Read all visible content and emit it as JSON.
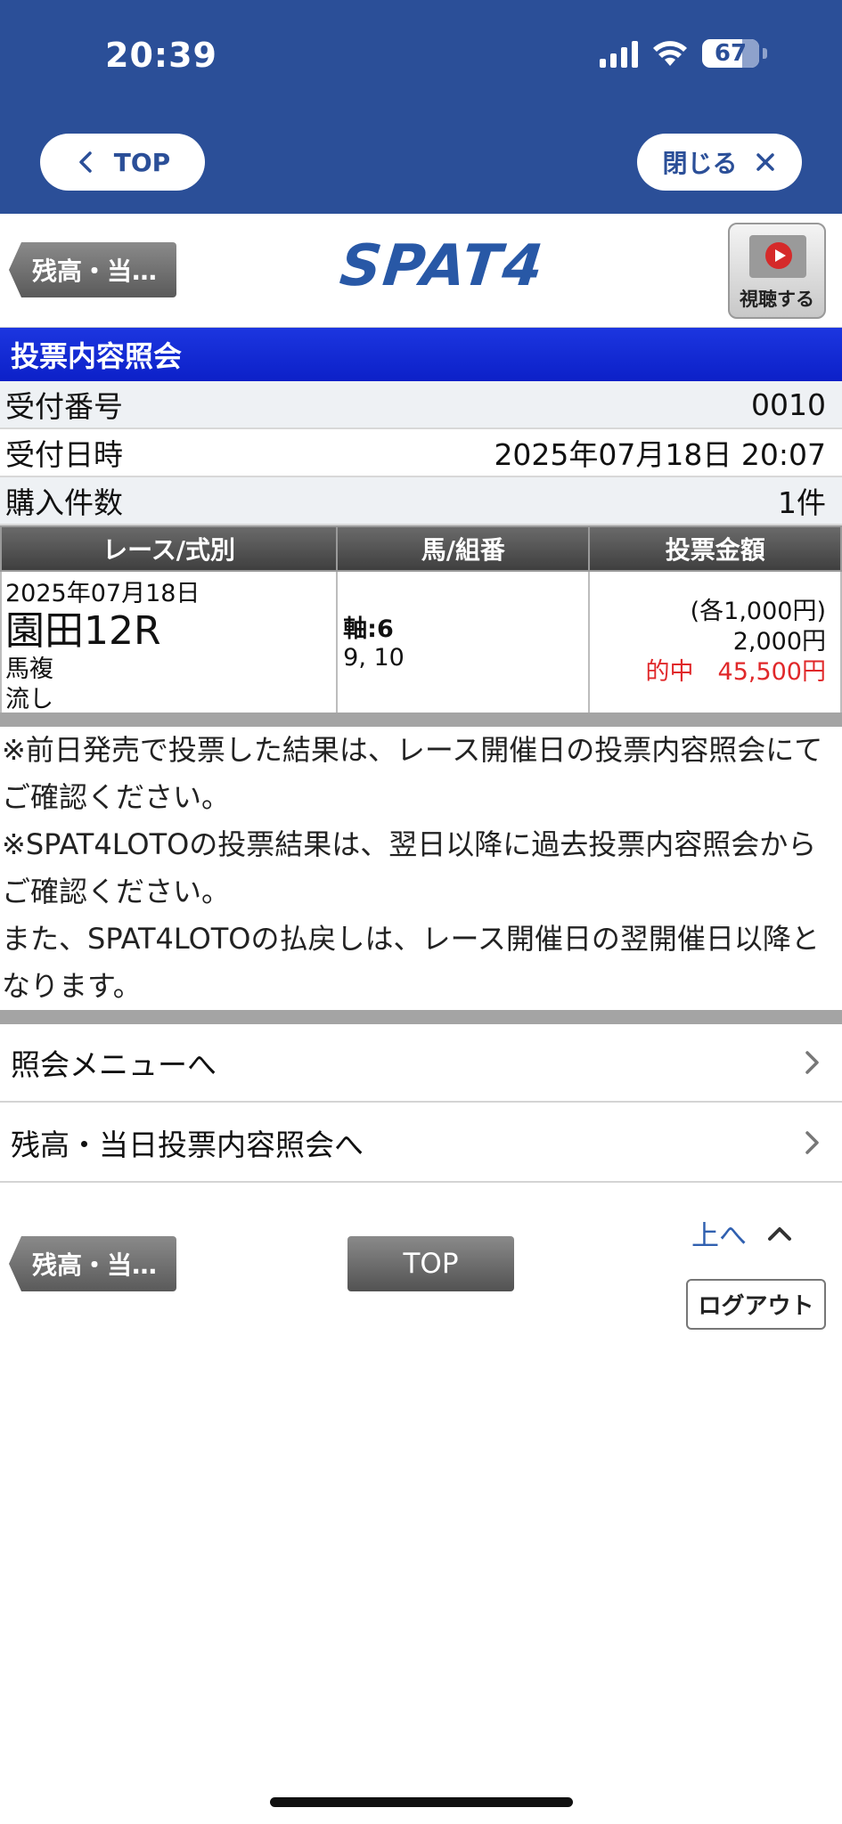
{
  "status_bar": {
    "time": "20:39",
    "battery": "67"
  },
  "header": {
    "top_label": "TOP",
    "close_label": "閉じる"
  },
  "logo_row": {
    "back_label": "残高・当…",
    "logo": "SPAT4",
    "watch_label": "視聴する"
  },
  "section": {
    "title": "投票内容照会"
  },
  "info": [
    {
      "label": "受付番号",
      "value": "0010"
    },
    {
      "label": "受付日時",
      "value": "2025年07月18日 20:07"
    },
    {
      "label": "購入件数",
      "value": "1件"
    }
  ],
  "table": {
    "headers": [
      "レース/式別",
      "馬/組番",
      "投票金額"
    ],
    "row": {
      "date": "2025年07月18日",
      "race": "園田12R",
      "bet_type": "馬複",
      "method": "流し",
      "axis": "軸:6",
      "numbers": "9, 10",
      "each": "(各1,000円)",
      "amount": "2,000円",
      "hit": "的中　45,500円"
    }
  },
  "notes": [
    "※前日発売で投票した結果は、レース開催日の投票内容照会にてご確認ください。",
    "※SPAT4LOTOの投票結果は、翌日以降に過去投票内容照会からご確認ください。",
    "また、SPAT4LOTOの払戻しは、レース開催日の翌開催日以降となります。"
  ],
  "menu": [
    {
      "label": "照会メニューへ"
    },
    {
      "label": "残高・当日投票内容照会へ"
    }
  ],
  "footer": {
    "back_label": "残高・当…",
    "top_label": "TOP",
    "up_label": "上へ",
    "logout_label": "ログアウト"
  }
}
